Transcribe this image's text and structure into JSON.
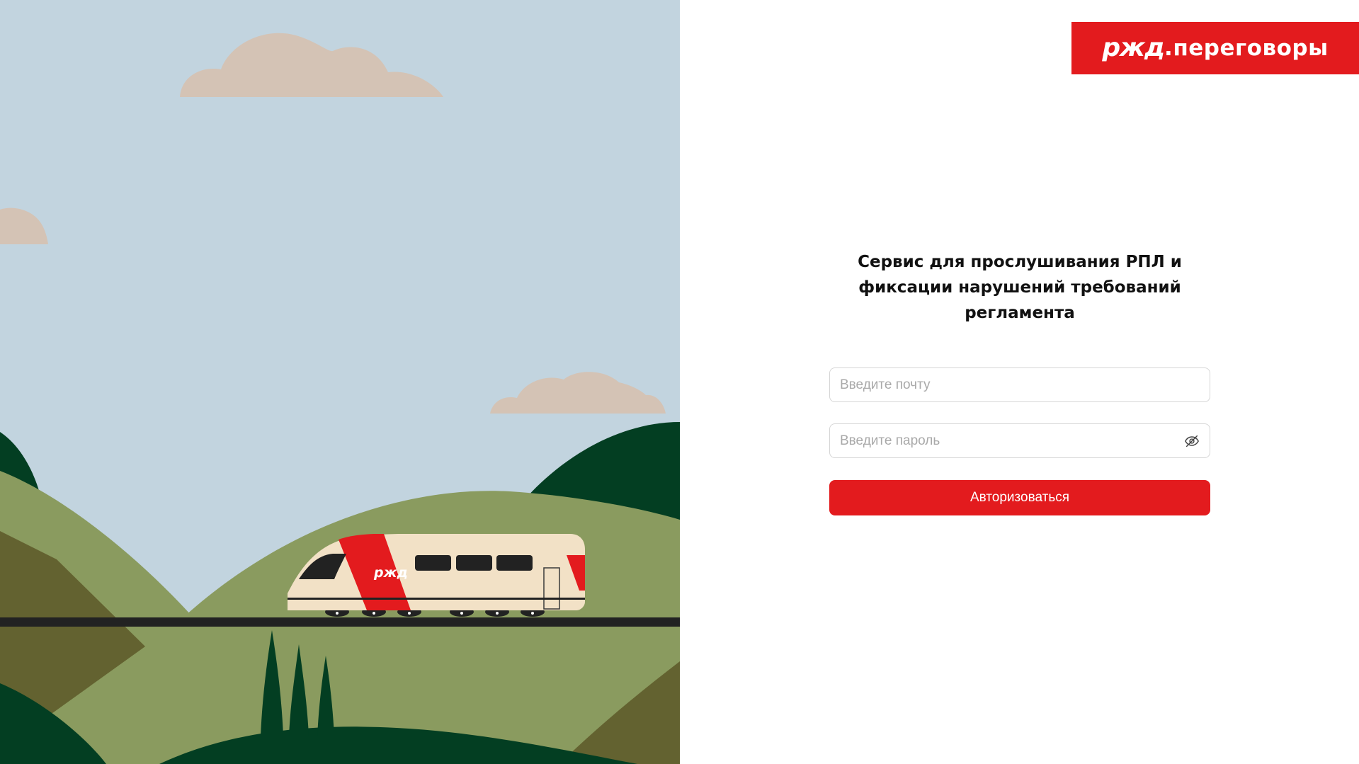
{
  "logo": {
    "brand": "ржд",
    "suffix": ".переговоры"
  },
  "login": {
    "heading_line1": "Сервис для прослушивания РПЛ и",
    "heading_line2": "фиксации нарушений требований",
    "heading_line3": "регламента",
    "email_placeholder": "Введите почту",
    "password_placeholder": "Введите пароль",
    "submit_label": "Авторизоваться"
  },
  "illustration": {
    "train_logo": "ржд"
  },
  "colors": {
    "brand_red": "#e31b1e",
    "sky": "#c2d4df",
    "cloud": "#d4c3b5",
    "hill_light": "#8a9b5f",
    "hill_dark": "#033e22",
    "hill_olive": "#636230"
  },
  "icons": {
    "password_toggle": "eye-off-icon"
  }
}
